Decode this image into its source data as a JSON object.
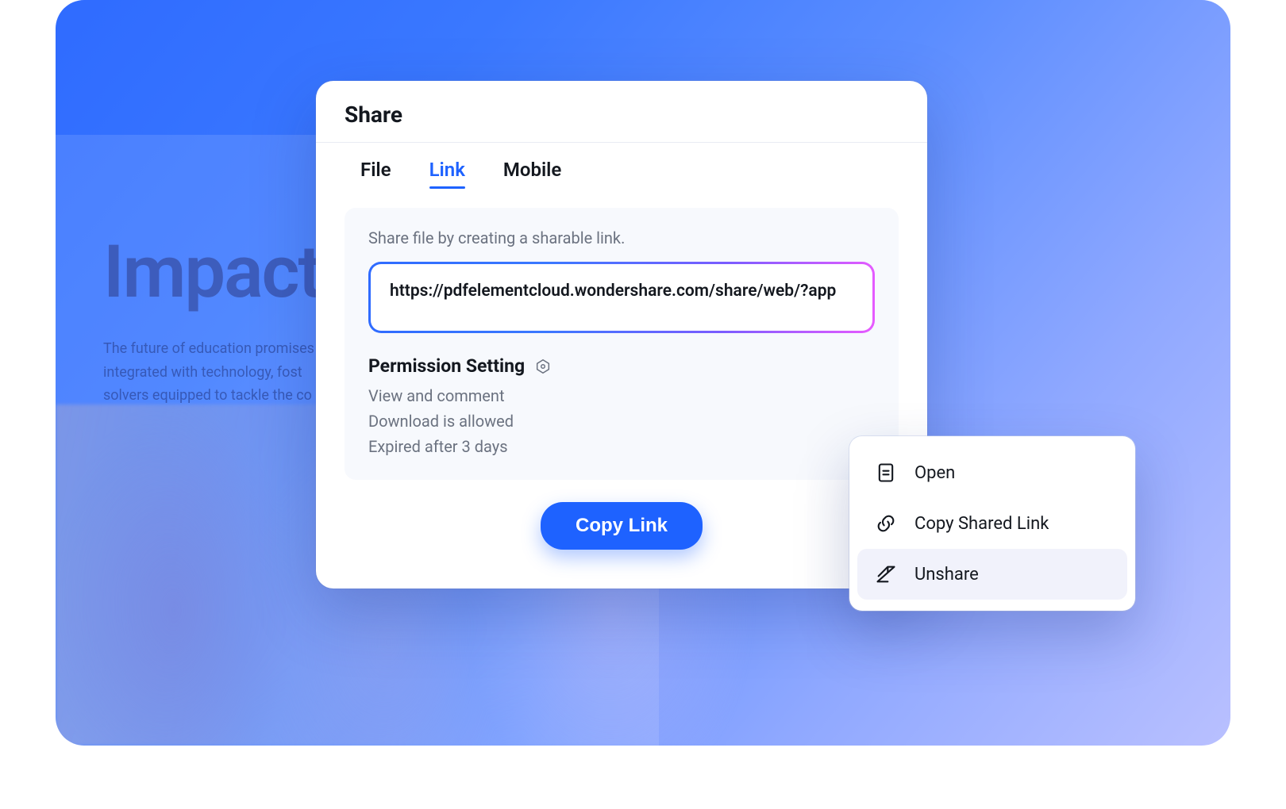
{
  "background": {
    "heading": "Impact",
    "body_line1": "The future of education promises",
    "body_line2": "integrated with technology, fost",
    "body_line3": "solvers equipped to tackle the co"
  },
  "dialog": {
    "title": "Share",
    "tabs": {
      "file": "File",
      "link": "Link",
      "mobile": "Mobile"
    },
    "hint": "Share file by creating a sharable link.",
    "link_url": "https://pdfelementcloud.wondershare.com/share/web/?app",
    "permissions": {
      "heading": "Permission Setting",
      "items": [
        "View and comment",
        "Download is allowed",
        "Expired after 3 days"
      ]
    },
    "copy_button": "Copy Link"
  },
  "menu": {
    "open": "Open",
    "copy": "Copy Shared Link",
    "unshare": "Unshare"
  }
}
